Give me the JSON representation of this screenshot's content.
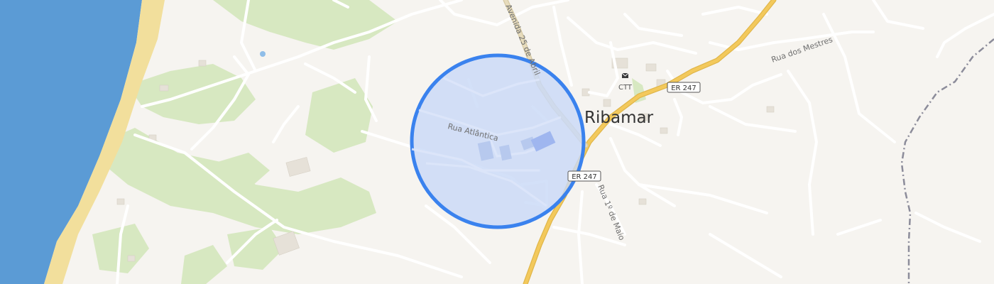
{
  "map": {
    "place_label": "Ribamar",
    "streets": {
      "avenida": "Avenida 25 de Abril",
      "rua_atlantica": "Rua Atlântica",
      "rua_mestres": "Rua dos Mestres",
      "rua_maio": "Rua 1º de Maio"
    },
    "road_shields": [
      {
        "label": "ER 247"
      },
      {
        "label": "ER 247"
      }
    ],
    "poi": {
      "label": "CTT",
      "icon": "mail-icon"
    },
    "colors": {
      "water": "#5b9bd5",
      "beach": "#f2df9c",
      "vegetation": "#d7e8c1",
      "land": "#f6f4f0",
      "major_road": "#f3c95c",
      "railway": "#8c8c9a",
      "search_area_fill": "#c9d9f7",
      "search_area_stroke": "#3a82ee"
    }
  }
}
